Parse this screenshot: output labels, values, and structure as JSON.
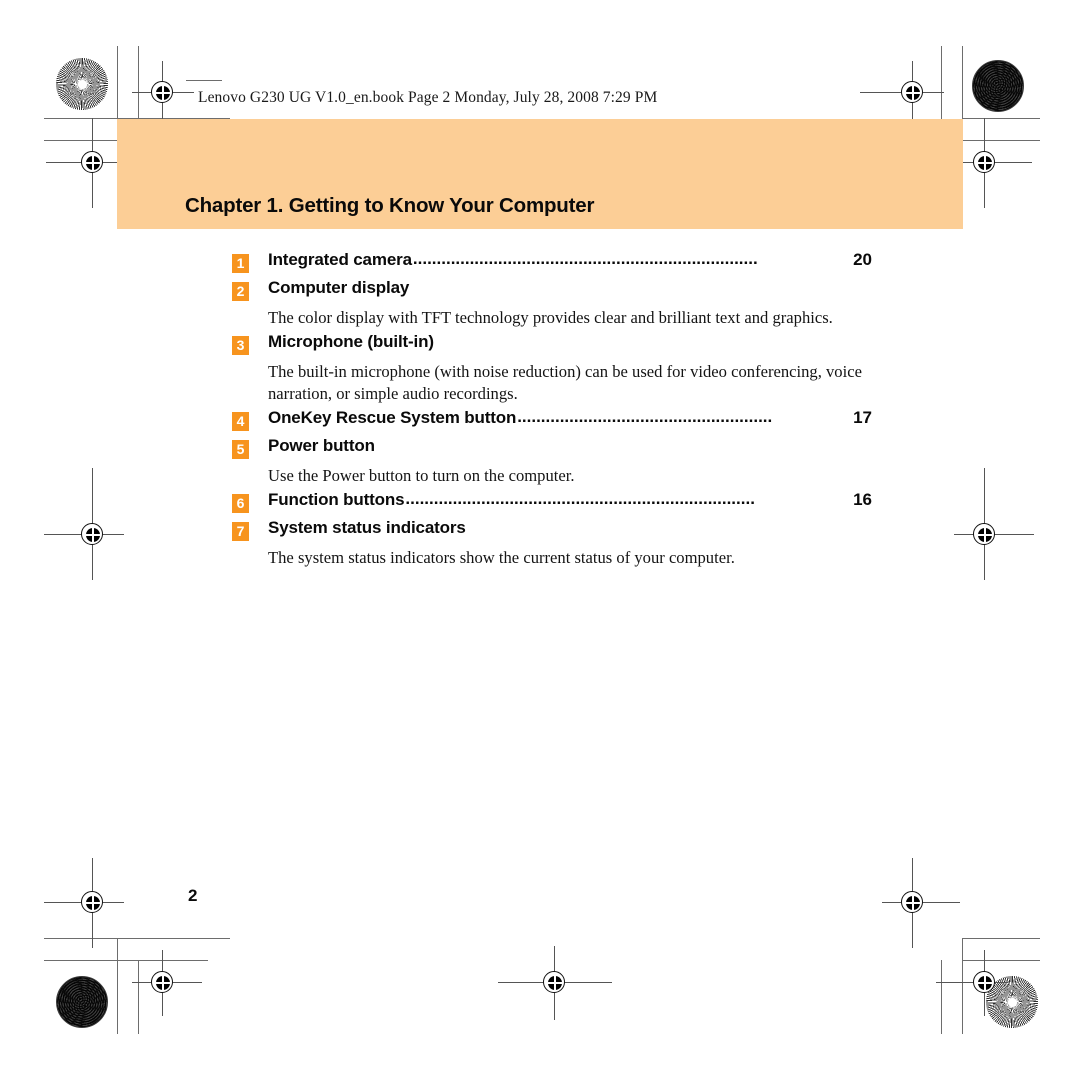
{
  "header": {
    "text": "Lenovo G230 UG V1.0_en.book  Page 2  Monday, July 28, 2008  7:29 PM"
  },
  "chapter": {
    "title": "Chapter 1. Getting to Know Your Computer",
    "band_color": "#FCCE96"
  },
  "badge_color": "#F7941E",
  "items": [
    {
      "num": "1",
      "title": "Integrated camera",
      "leader": ".........................................................................",
      "page": "20",
      "body": ""
    },
    {
      "num": "2",
      "title": "Computer display",
      "leader": "",
      "page": "",
      "body": "The color display with TFT technology provides clear and brilliant text and graphics."
    },
    {
      "num": "3",
      "title": "Microphone (built-in)",
      "leader": "",
      "page": "",
      "body": "The built-in microphone (with noise reduction) can be used for video conferencing, voice narration, or simple audio recordings."
    },
    {
      "num": "4",
      "title": "OneKey Rescue System button",
      "leader": "......................................................",
      "page": "17",
      "body": ""
    },
    {
      "num": "5",
      "title": "Power button",
      "leader": "",
      "page": "",
      "body": "Use the Power button to turn on the computer."
    },
    {
      "num": "6",
      "title": "Function buttons",
      "leader": "..........................................................................",
      "page": "16",
      "body": ""
    },
    {
      "num": "7",
      "title": "System status indicators",
      "leader": "",
      "page": "",
      "body": "The system status indicators show the current status of your computer."
    }
  ],
  "folio": {
    "page_number": "2"
  }
}
